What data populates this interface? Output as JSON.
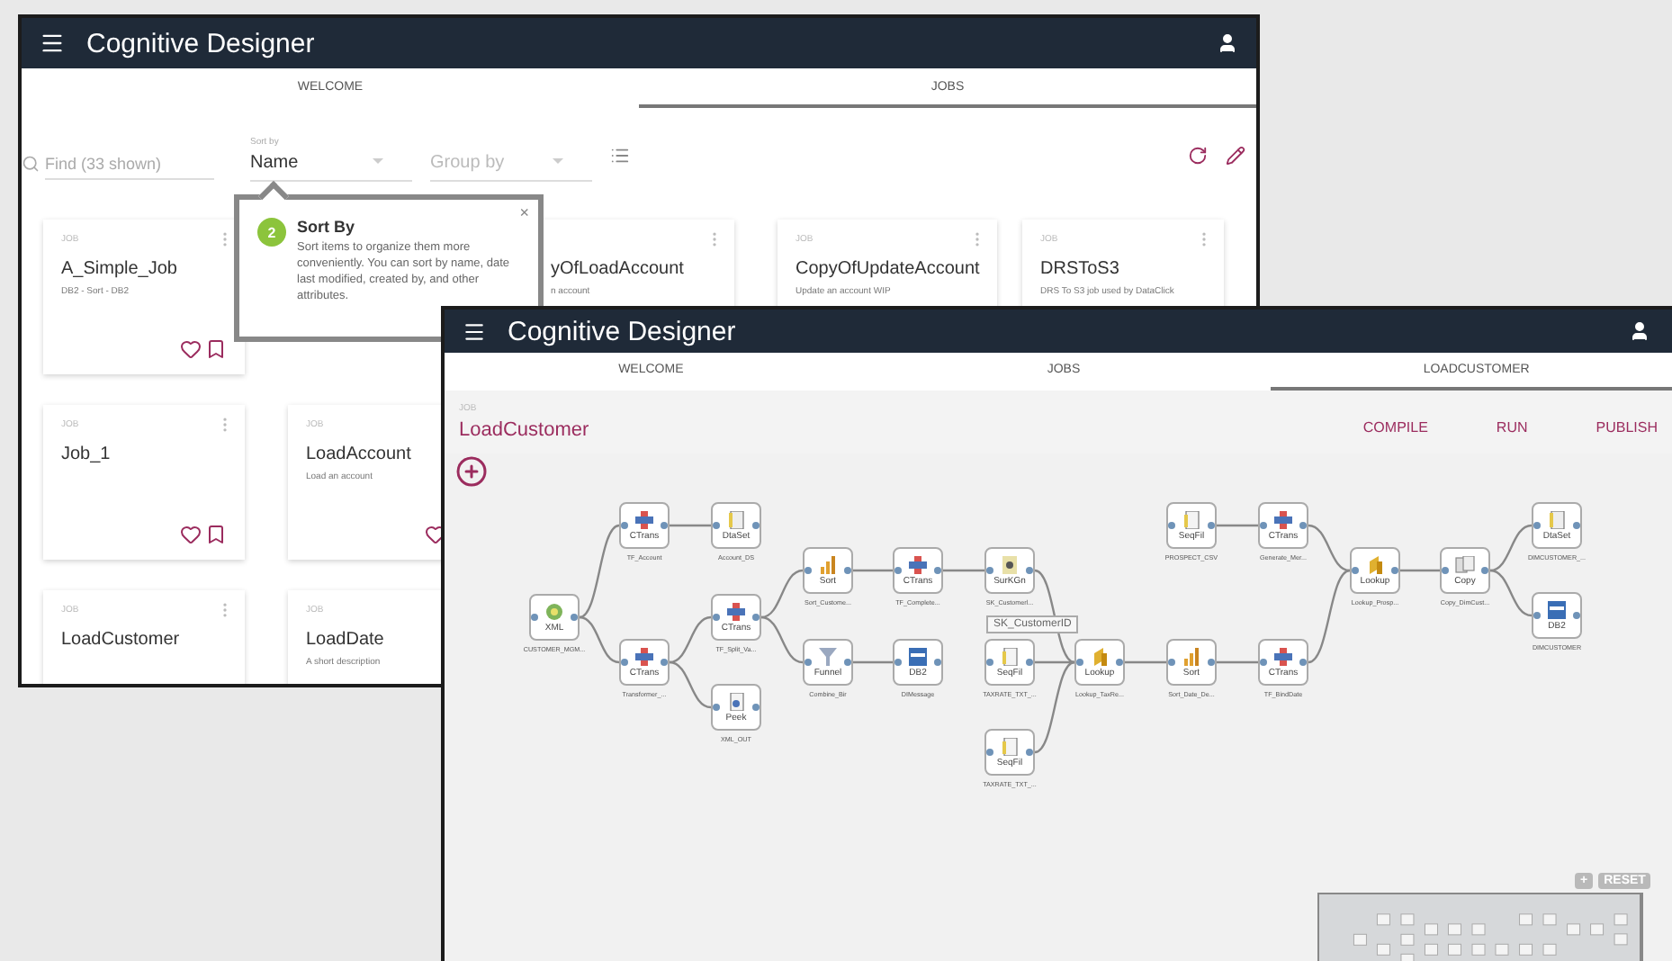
{
  "background_window": {
    "title": "Cognitive Designer",
    "tabs": [
      {
        "label": "WELCOME",
        "selected": false
      },
      {
        "label": "JOBS",
        "selected": true
      }
    ],
    "search": {
      "placeholder": "Find (33 shown)"
    },
    "sort": {
      "label": "Sort by",
      "value": "Name"
    },
    "group": {
      "placeholder": "Group by"
    },
    "card_rows": [
      {
        "items": [
          {
            "kind": "card",
            "type": "JOB",
            "title": "A_Simple_Job",
            "description": "DB2 - Sort - DB2",
            "favorite": false,
            "bookmarked": false
          },
          {
            "kind": "popover",
            "step": "2",
            "title": "Sort By",
            "text": "Sort items to organize them more conveniently. You can sort by name, date last modified, created by, and other attributes.",
            "close": "×"
          },
          {
            "kind": "card",
            "title": "yOfLoadAccount",
            "description": "n account"
          },
          {
            "kind": "card",
            "type": "JOB",
            "title": "CopyOfUpdateAccount",
            "description": "Update an account WIP"
          },
          {
            "kind": "card",
            "type": "JOB",
            "title": "DRSToS3",
            "description": "DRS To S3 job used by DataClick"
          }
        ]
      },
      {
        "items": [
          {
            "kind": "card",
            "type": "JOB",
            "title": "Job_1",
            "favorite": false,
            "bookmarked": false
          },
          {
            "kind": "card",
            "type": "JOB",
            "title": "LoadAccount",
            "description": "Load an account",
            "favorite": false
          }
        ]
      },
      {
        "items": [
          {
            "kind": "card",
            "type": "JOB",
            "title": "LoadCustomer"
          },
          {
            "kind": "card",
            "type": "JOB",
            "title": "LoadDate",
            "description": "A short description"
          }
        ]
      }
    ]
  },
  "front_window": {
    "title": "Cognitive Designer",
    "tabs": [
      {
        "label": "WELCOME",
        "selected": false
      },
      {
        "label": "JOBS",
        "selected": false
      },
      {
        "label": "LOADCUSTOMER",
        "selected": true
      }
    ],
    "job": {
      "type": "JOB",
      "name": "LoadCustomer"
    },
    "actions": [
      "COMPILE",
      "RUN",
      "PUBLISH"
    ],
    "nodes": [
      {
        "kind": "transformer",
        "label": "CTrans",
        "caption": "TF_Account"
      },
      {
        "kind": "dataset",
        "label": "DtaSet",
        "caption": "Account_DS"
      },
      {
        "kind": "file",
        "label": "SeqFil",
        "caption": "PROSPECT_CSV"
      },
      {
        "kind": "transformer",
        "label": "CTrans",
        "caption": "Generate_Mer..."
      },
      {
        "kind": "dataset",
        "label": "DtaSet",
        "caption": "DIMCUSTOMER_..."
      },
      {
        "kind": "sort",
        "label": "Sort",
        "caption": "Sort_Custome..."
      },
      {
        "kind": "transformer",
        "label": "CTrans",
        "caption": "TF_Complete..."
      },
      {
        "kind": "keygen",
        "label": "SurKGn",
        "caption": "SK_Customerl..."
      },
      {
        "kind": "lookup",
        "label": "Lookup",
        "caption": "Lookup_Prosp..."
      },
      {
        "kind": "copy",
        "label": "Copy",
        "caption": "Copy_DimCust..."
      },
      {
        "kind": "xml",
        "label": "XML",
        "caption": "CUSTOMER_MGM..."
      },
      {
        "kind": "transformer",
        "label": "CTrans",
        "caption": "TF_Split_Va..."
      },
      {
        "kind": "db2",
        "label": "DB2",
        "caption": "DIMCUSTOMER"
      },
      {
        "kind": "transformer",
        "label": "CTrans",
        "caption": "Transformer_..."
      },
      {
        "kind": "funnel",
        "label": "Funnel",
        "caption": "Combine_Bir"
      },
      {
        "kind": "db2",
        "label": "DB2",
        "caption": "DIMessage"
      },
      {
        "kind": "file",
        "label": "SeqFil",
        "caption": "TAXRATE_TXT_..."
      },
      {
        "kind": "lookup",
        "label": "Lookup",
        "caption": "Lookup_TaxRe..."
      },
      {
        "kind": "sort",
        "label": "Sort",
        "caption": "Sort_Date_De..."
      },
      {
        "kind": "transformer",
        "label": "CTrans",
        "caption": "TF_BindDate"
      },
      {
        "kind": "peek",
        "label": "Peek",
        "caption": "XML_OUT"
      },
      {
        "kind": "file",
        "label": "SeqFil",
        "caption": "TAXRATE_TXT_..."
      }
    ],
    "tooltip": "SK_CustomerID",
    "minimap": {
      "zoom_in": "+",
      "reset": "RESET"
    }
  }
}
